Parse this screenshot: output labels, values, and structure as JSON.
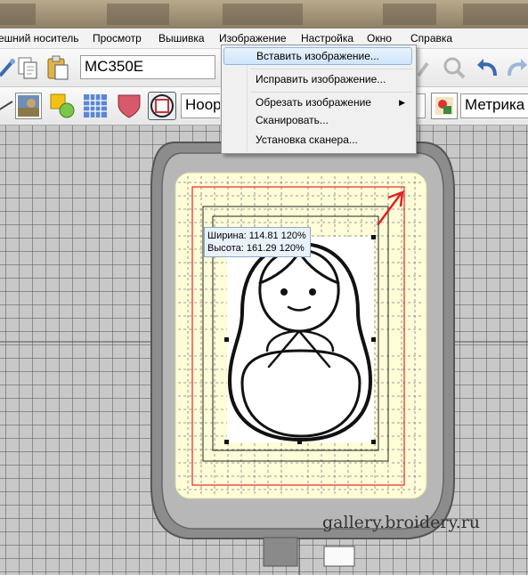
{
  "menubar": {
    "items": [
      "ешний носитель",
      "Просмотр",
      "Вышивка",
      "Изображение",
      "Настройка",
      "Окно",
      "Справка"
    ]
  },
  "toolbar": {
    "machine_value": "MC350E",
    "hoop_value": "Hoop",
    "units_value": "Метрика"
  },
  "image_menu": {
    "items": [
      {
        "label": "Вставить изображение...",
        "highlighted": true,
        "submenu": false
      },
      {
        "label": "Исправить изображение...",
        "highlighted": false,
        "submenu": false
      },
      {
        "label": "Обрезать изображение",
        "highlighted": false,
        "submenu": true
      },
      {
        "label": "Сканировать...",
        "highlighted": false,
        "submenu": false
      },
      {
        "label": "Установка сканера...",
        "highlighted": false,
        "submenu": false
      }
    ]
  },
  "size_tooltip": {
    "width_text": "Ширина: 114.81 120%",
    "height_text": "Высота: 161.29 120%"
  },
  "watermark": "gallery.broidery.ru",
  "colors": {
    "hoop_area": "#fffdd8",
    "red_frame": "#e33",
    "menu_highlight": "#cfe4fb"
  }
}
